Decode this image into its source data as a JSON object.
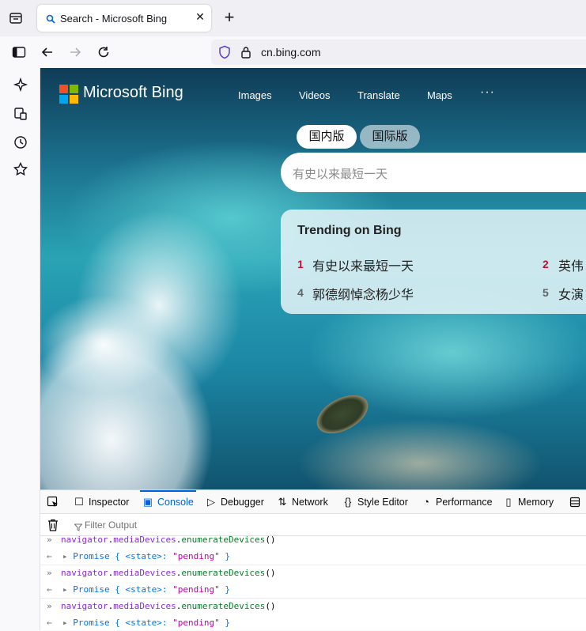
{
  "browser": {
    "tab": {
      "title": "Search - Microsoft Bing",
      "close": "✕",
      "new_tab": "+"
    },
    "url": {
      "host": "cn.bing.com"
    }
  },
  "page": {
    "brand": "Microsoft Bing",
    "nav": [
      "Images",
      "Videos",
      "Translate",
      "Maps",
      "···"
    ],
    "toggle": {
      "active": "国内版",
      "inactive": "国际版"
    },
    "search_placeholder": "有史以来最短一天",
    "trending": {
      "title": "Trending on Bing",
      "items": [
        {
          "num": "1",
          "text": "有史以来最短一天",
          "color": "#c8102e"
        },
        {
          "num": "2",
          "text": "英伟",
          "color": "#c8102e"
        },
        {
          "num": "4",
          "text": "郭德纲悼念杨少华",
          "color": "#5f6368"
        },
        {
          "num": "5",
          "text": "女演",
          "color": "#5f6368"
        }
      ]
    }
  },
  "devtools": {
    "tabs": [
      "Inspector",
      "Console",
      "Debugger",
      "Network",
      "Style Editor",
      "Performance",
      "Memory"
    ],
    "active_tab": "Console",
    "filter_placeholder": "Filter Output",
    "rows": [
      {
        "type": "input",
        "obj": "navigator",
        "dot1": ".",
        "prop": "mediaDevices",
        "dot2": ".",
        "method": "enumerateDevices",
        "parens": "()"
      },
      {
        "type": "result",
        "label": "Promise { <state>: ",
        "value": "\"pending\"",
        "end": " }"
      },
      {
        "type": "input",
        "obj": "navigator",
        "dot1": ".",
        "prop": "mediaDevices",
        "dot2": ".",
        "method": "enumerateDevices",
        "parens": "()"
      },
      {
        "type": "result",
        "label": "Promise { <state>: ",
        "value": "\"pending\"",
        "end": " }"
      },
      {
        "type": "input",
        "obj": "navigator",
        "dot1": ".",
        "prop": "mediaDevices",
        "dot2": ".",
        "method": "enumerateDevices",
        "parens": "()"
      },
      {
        "type": "result",
        "label": "Promise { <state>: ",
        "value": "\"pending\"",
        "end": " }"
      }
    ]
  },
  "colors": {
    "accent": "#0060df",
    "bing_red": "#f25022",
    "bing_green": "#7fba00",
    "bing_blue": "#00a4ef",
    "bing_yellow": "#ffb900"
  }
}
